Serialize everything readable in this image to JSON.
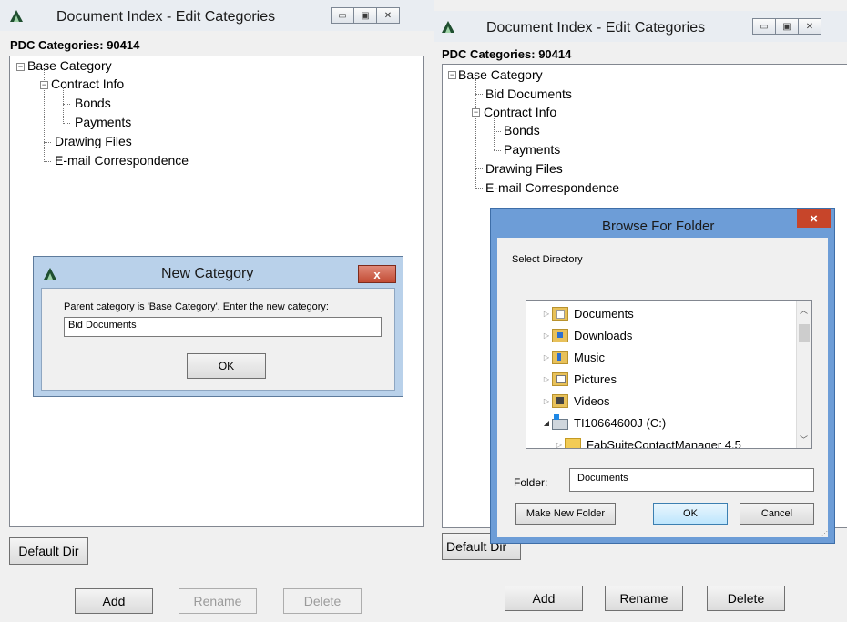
{
  "left_window": {
    "title": "Document Index - Edit Categories",
    "categories_label": "PDC Categories: 90414",
    "tree": {
      "root": "Base Category",
      "contract_info": "Contract Info",
      "bonds": "Bonds",
      "payments": "Payments",
      "drawing_files": "Drawing Files",
      "email": "E-mail Correspondence"
    },
    "default_dir": "Default Dir",
    "add": "Add",
    "rename": "Rename",
    "delete": "Delete"
  },
  "new_category_dialog": {
    "title": "New Category",
    "prompt": "Parent category is 'Base Category'.  Enter the new category:",
    "value": "Bid Documents",
    "ok": "OK",
    "close": "x"
  },
  "right_window": {
    "title": "Document Index - Edit Categories",
    "categories_label": "PDC Categories: 90414",
    "tree": {
      "root": "Base Category",
      "bid_documents": "Bid Documents",
      "contract_info": "Contract Info",
      "bonds": "Bonds",
      "payments": "Payments",
      "drawing_files": "Drawing Files",
      "email": "E-mail Correspondence"
    },
    "default_dir": "Default Dir",
    "add": "Add",
    "rename": "Rename",
    "delete": "Delete"
  },
  "browse_dialog": {
    "title": "Browse For Folder",
    "close": "×",
    "prompt": "Select Directory",
    "folders": {
      "documents": "Documents",
      "downloads": "Downloads",
      "music": "Music",
      "pictures": "Pictures",
      "videos": "Videos",
      "drive": "TI10664600J (C:)",
      "fabsuite": "FabSuiteContactManager 4.5"
    },
    "folder_label": "Folder:",
    "folder_value": "Documents",
    "make_new_folder": "Make New Folder",
    "ok": "OK",
    "cancel": "Cancel"
  },
  "colors": {
    "title_bar": "#e9edf2",
    "dialog_frame": "#b9d1ea",
    "browse_frame": "#6d9dd7",
    "close_red": "#c24b33",
    "selection": "#cce8ff"
  }
}
